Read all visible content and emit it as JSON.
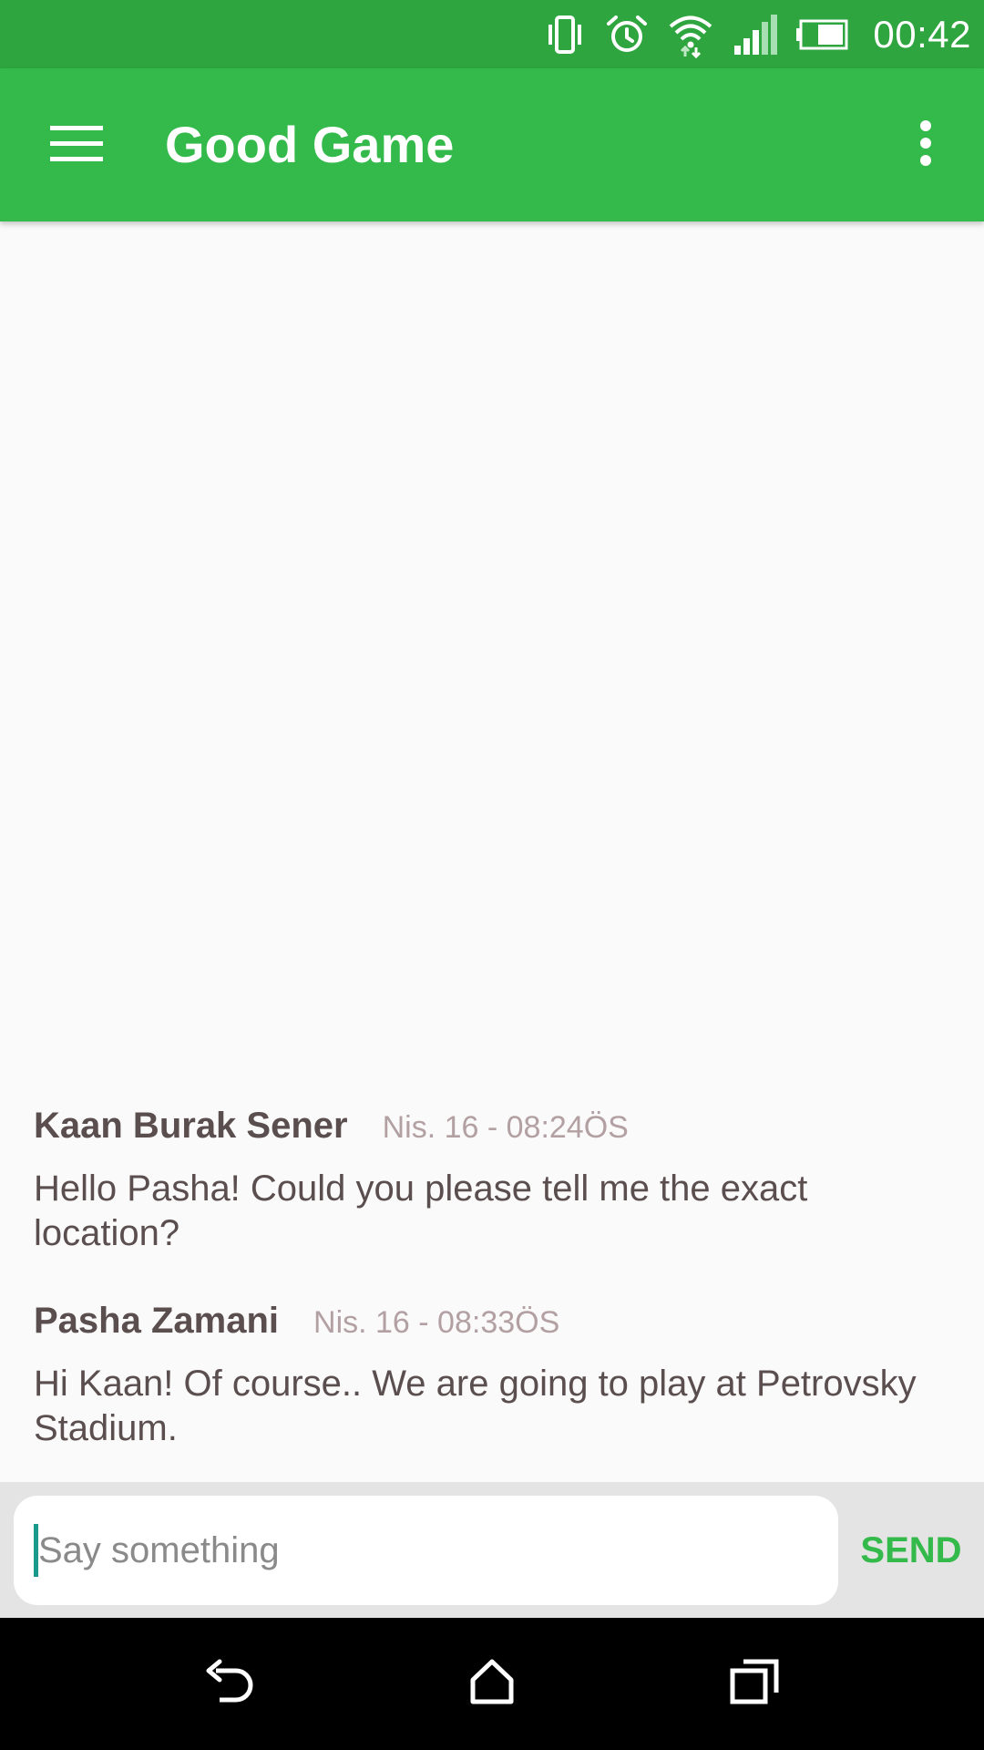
{
  "status_bar": {
    "time": "00:42",
    "icons": [
      "vibrate-icon",
      "alarm-icon",
      "wifi-icon",
      "signal-icon",
      "battery-icon"
    ]
  },
  "app_bar": {
    "title": "Good Game",
    "menu_icon": "hamburger-menu-icon",
    "overflow_icon": "more-vert-icon",
    "background_color": "#34b94b"
  },
  "messages": [
    {
      "author": "Kaan Burak Sener",
      "time": "Nis. 16 - 08:24ÖS",
      "text": "Hello Pasha! Could you please tell me the exact location?"
    },
    {
      "author": "Pasha Zamani",
      "time": "Nis. 16 - 08:33ÖS",
      "text": "Hi Kaan! Of course.. We are going to play at Petrovsky Stadium."
    }
  ],
  "composer": {
    "placeholder": "Say something",
    "value": "",
    "send_label": "SEND",
    "accent_color": "#34b94b"
  },
  "nav_bar": {
    "icons": [
      "back-icon",
      "home-icon",
      "recents-icon"
    ]
  }
}
